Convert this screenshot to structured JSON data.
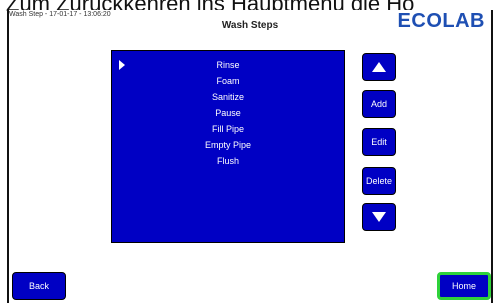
{
  "caption": "Zum Zurückkehren ins Hauptmenü die Ho",
  "header": {
    "info": "Wash Step - 17-01-17 - 13:06:20",
    "title": "Wash Steps",
    "logo": "ECOLAB"
  },
  "steps": [
    "Rinse",
    "Foam",
    "Sanitize",
    "Pause",
    "Fill Pipe",
    "Empty Pipe",
    "Flush"
  ],
  "buttons": {
    "add": "Add",
    "edit": "Edit",
    "delete": "Delete",
    "back": "Back",
    "home": "Home"
  },
  "icons": {
    "selection": "selection-arrow-icon",
    "up": "up-arrow-icon",
    "down": "down-arrow-icon"
  },
  "colors": {
    "panel": "#0000c4",
    "logo": "#1e4fb3",
    "home_highlight": "#2fd23a"
  }
}
